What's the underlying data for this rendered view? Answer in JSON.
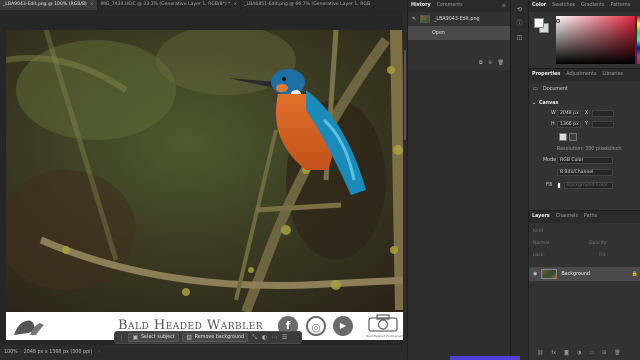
{
  "tabs": [
    {
      "title": "_LBA9043-Edit.png @ 100% (RGB/8)",
      "active": true
    },
    {
      "title": "IMG_7434.HEIC @ 33.3% (Generative Layer 1, RGB/8*) *",
      "active": false
    },
    {
      "title": "_LBA6851-Edit.png @ 66.7% (Generative Layer 1, RGB",
      "active": false
    }
  ],
  "tab_close": "×",
  "footer": {
    "brand": "Bald Headed Warbler",
    "social": {
      "facebook": "f",
      "instagram": "◎",
      "youtube": "▶"
    },
    "camera_caption": "Bald Headed Photography"
  },
  "taskbar": {
    "select_subject": "Select subject",
    "remove_background": "Remove background"
  },
  "status": {
    "zoom": "100%",
    "doc_info": "2048 px x 1366 px (300 ppi)",
    "chevron": "›"
  },
  "history": {
    "tab_history": "History",
    "tab_comments": "Comments",
    "snapshot_label": "_LBA9043-Edit.png",
    "state_open": "Open"
  },
  "color_panel": {
    "tabs": [
      "Color",
      "Swatches",
      "Gradients",
      "Patterns"
    ],
    "accent": "#e0233c"
  },
  "properties": {
    "tabs": [
      "Properties",
      "Adjustments",
      "Libraries"
    ],
    "doc_label": "Document",
    "canvas_heading": "Canvas",
    "w_label": "W",
    "w_value": "2048 px",
    "x_label": "X",
    "h_label": "H",
    "h_value": "1366 px",
    "y_label": "Y",
    "resolution": "Resolution: 300 pixels/inch",
    "mode_label": "Mode",
    "mode_value": "RGB Color",
    "bits_value": "8 Bits/Channel",
    "fill_label": "Fill",
    "fill_value": "Background Color"
  },
  "layers": {
    "tabs": [
      "Layers",
      "Channels",
      "Paths"
    ],
    "kind": "Kind",
    "blend": "Normal",
    "opacity": "Opacity:",
    "lock": "Lock:",
    "fill": "Fill:",
    "layer_name": "Background"
  }
}
